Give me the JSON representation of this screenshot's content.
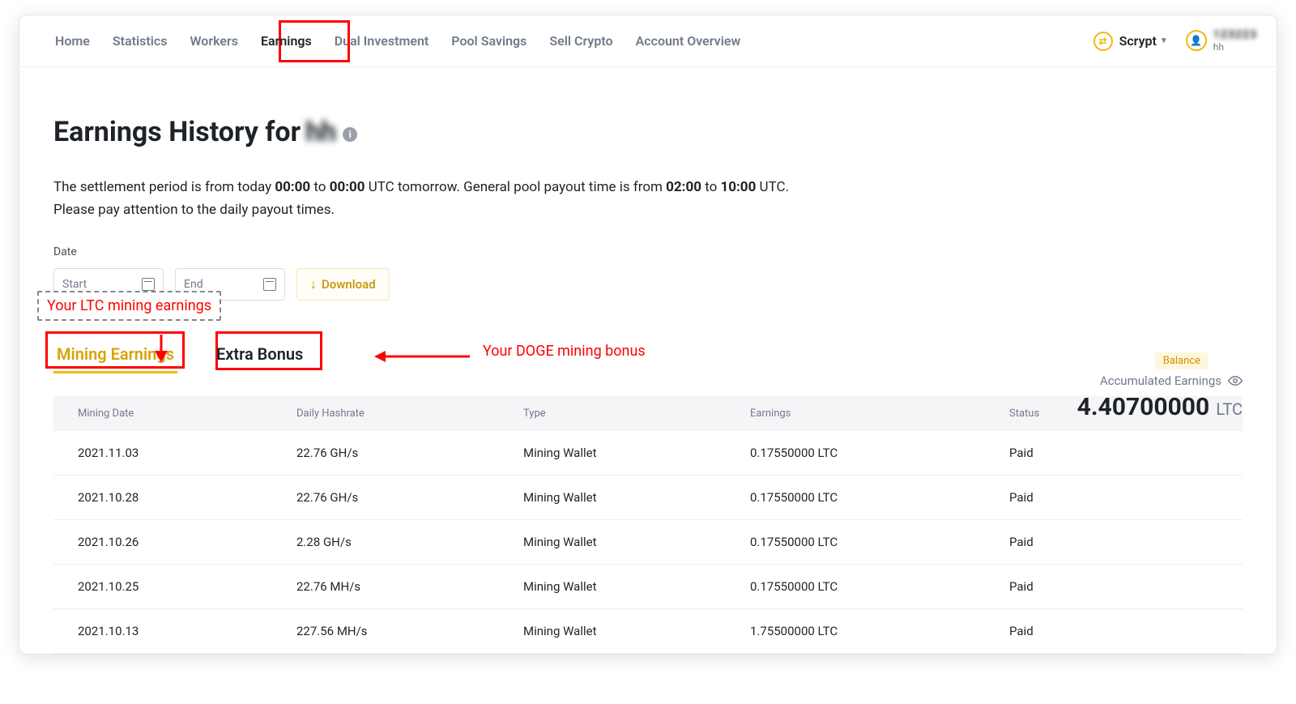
{
  "nav": {
    "items": [
      "Home",
      "Statistics",
      "Workers",
      "Earnings",
      "Dual Investment",
      "Pool Savings",
      "Sell Crypto",
      "Account Overview"
    ],
    "active_index": 3,
    "algo_label": "Scrypt",
    "user_id": "123223",
    "user_sub": "hh"
  },
  "page": {
    "title_prefix": "Earnings History for ",
    "title_user": "hh",
    "desc_html_parts": {
      "p1a": "The settlement period is from today ",
      "p1b": "00:00",
      "p1c": " to ",
      "p1d": "00:00",
      "p1e": " UTC tomorrow. General pool payout time is from ",
      "p1f": "02:00",
      "p1g": " to ",
      "p1h": "10:00",
      "p1i": " UTC.",
      "p2": "Please pay attention to the daily payout times."
    },
    "date_label": "Date",
    "start_placeholder": "Start",
    "end_placeholder": "End",
    "download_label": "Download",
    "balance_pill": "Balance",
    "accum_label": "Accumulated Earnings",
    "accum_value": "4.40700000",
    "accum_unit": "LTC"
  },
  "annotations": {
    "ltc_box": "Your LTC mining earnings",
    "doge_text": "Your DOGE mining bonus"
  },
  "tabs": {
    "mining": "Mining Earnings",
    "extra": "Extra Bonus"
  },
  "table": {
    "headers": [
      "Mining Date",
      "Daily Hashrate",
      "Type",
      "Earnings",
      "Status"
    ],
    "rows": [
      {
        "date": "2021.11.03",
        "hash": "22.76 GH/s",
        "type": "Mining Wallet",
        "earn": "0.17550000 LTC",
        "status": "Paid"
      },
      {
        "date": "2021.10.28",
        "hash": "22.76 GH/s",
        "type": "Mining Wallet",
        "earn": "0.17550000 LTC",
        "status": "Paid"
      },
      {
        "date": "2021.10.26",
        "hash": "2.28 GH/s",
        "type": "Mining Wallet",
        "earn": "0.17550000 LTC",
        "status": "Paid"
      },
      {
        "date": "2021.10.25",
        "hash": "22.76 MH/s",
        "type": "Mining Wallet",
        "earn": "0.17550000 LTC",
        "status": "Paid"
      },
      {
        "date": "2021.10.13",
        "hash": "227.56 MH/s",
        "type": "Mining Wallet",
        "earn": "1.75500000 LTC",
        "status": "Paid"
      }
    ]
  }
}
